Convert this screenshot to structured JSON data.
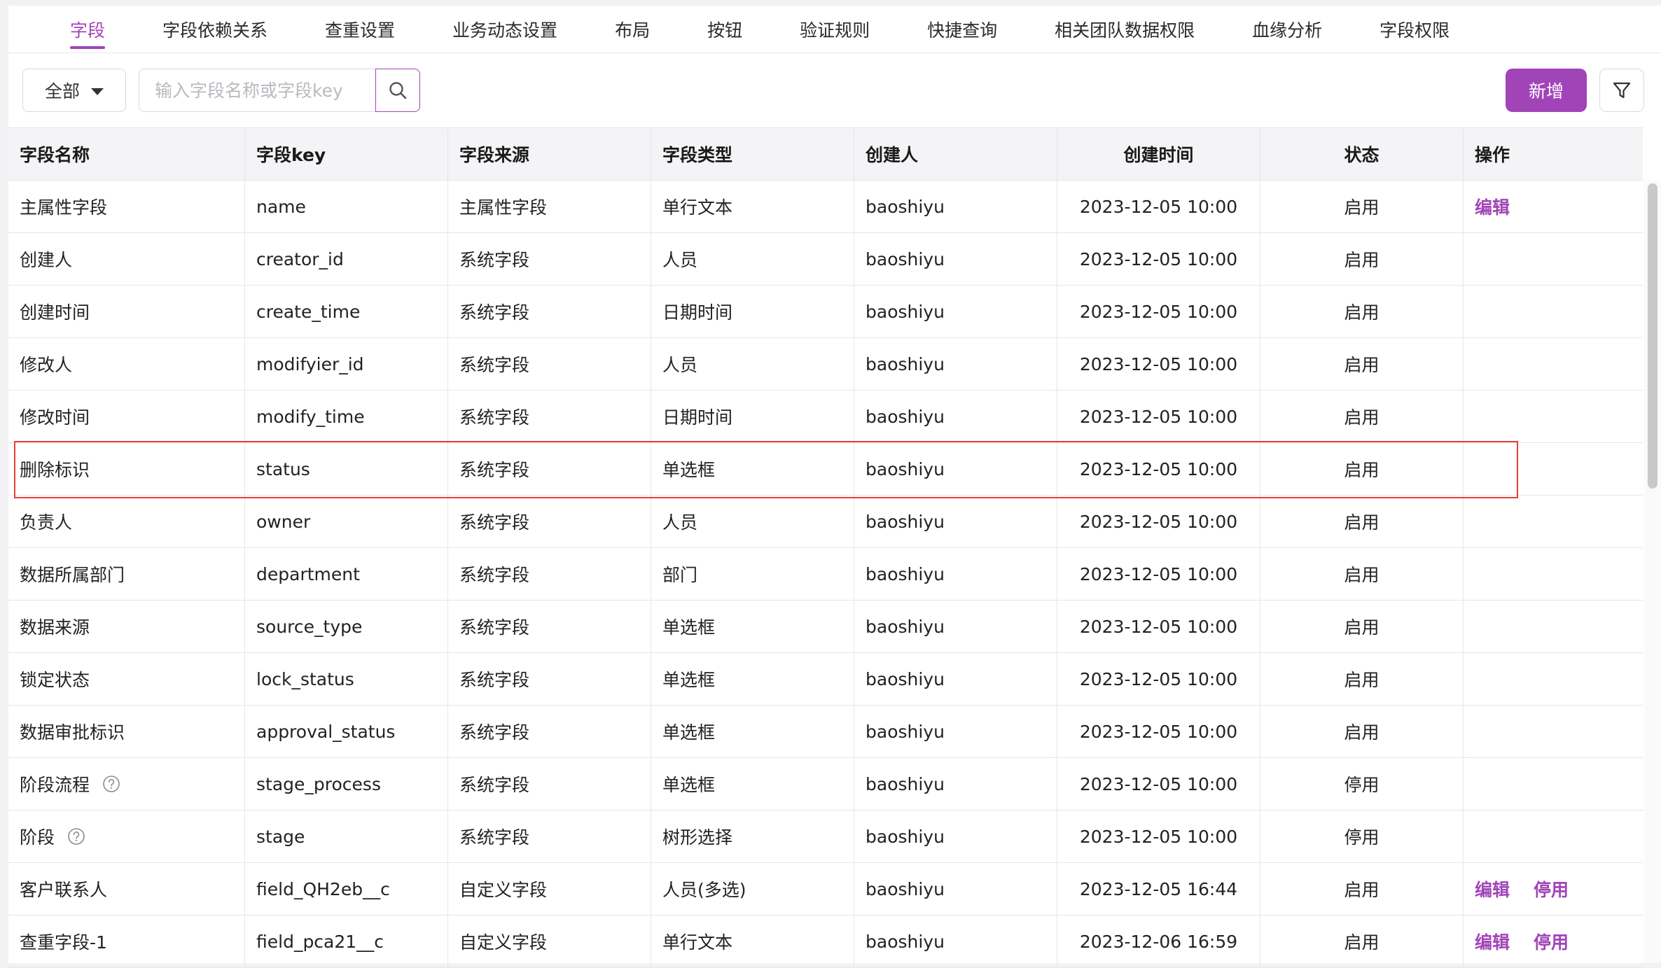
{
  "tabs": [
    {
      "label": "字段"
    },
    {
      "label": "字段依赖关系"
    },
    {
      "label": "查重设置"
    },
    {
      "label": "业务动态设置"
    },
    {
      "label": "布局"
    },
    {
      "label": "按钮"
    },
    {
      "label": "验证规则"
    },
    {
      "label": "快捷查询"
    },
    {
      "label": "相关团队数据权限"
    },
    {
      "label": "血缘分析"
    },
    {
      "label": "字段权限"
    }
  ],
  "active_tab": "字段",
  "toolbar": {
    "scope": "全部",
    "search_placeholder": "输入字段名称或字段key",
    "add_label": "新增"
  },
  "table": {
    "columns": [
      "字段名称",
      "字段key",
      "字段来源",
      "字段类型",
      "创建人",
      "创建时间",
      "状态",
      "操作"
    ],
    "rows": [
      {
        "name": "主属性字段",
        "key": "name",
        "source": "主属性字段",
        "type": "单行文本",
        "creator": "baoshiyu",
        "created": "2023-12-05 10:00",
        "status": "启用",
        "actions": [
          "编辑"
        ]
      },
      {
        "name": "创建人",
        "key": "creator_id",
        "source": "系统字段",
        "type": "人员",
        "creator": "baoshiyu",
        "created": "2023-12-05 10:00",
        "status": "启用",
        "actions": []
      },
      {
        "name": "创建时间",
        "key": "create_time",
        "source": "系统字段",
        "type": "日期时间",
        "creator": "baoshiyu",
        "created": "2023-12-05 10:00",
        "status": "启用",
        "actions": []
      },
      {
        "name": "修改人",
        "key": "modifyier_id",
        "source": "系统字段",
        "type": "人员",
        "creator": "baoshiyu",
        "created": "2023-12-05 10:00",
        "status": "启用",
        "actions": []
      },
      {
        "name": "修改时间",
        "key": "modify_time",
        "source": "系统字段",
        "type": "日期时间",
        "creator": "baoshiyu",
        "created": "2023-12-05 10:00",
        "status": "启用",
        "actions": []
      },
      {
        "name": "删除标识",
        "key": "status",
        "source": "系统字段",
        "type": "单选框",
        "creator": "baoshiyu",
        "created": "2023-12-05 10:00",
        "status": "启用",
        "actions": []
      },
      {
        "name": "负责人",
        "key": "owner",
        "source": "系统字段",
        "type": "人员",
        "creator": "baoshiyu",
        "created": "2023-12-05 10:00",
        "status": "启用",
        "actions": []
      },
      {
        "name": "数据所属部门",
        "key": "department",
        "source": "系统字段",
        "type": "部门",
        "creator": "baoshiyu",
        "created": "2023-12-05 10:00",
        "status": "启用",
        "actions": []
      },
      {
        "name": "数据来源",
        "key": "source_type",
        "source": "系统字段",
        "type": "单选框",
        "creator": "baoshiyu",
        "created": "2023-12-05 10:00",
        "status": "启用",
        "actions": []
      },
      {
        "name": "锁定状态",
        "key": "lock_status",
        "source": "系统字段",
        "type": "单选框",
        "creator": "baoshiyu",
        "created": "2023-12-05 10:00",
        "status": "启用",
        "actions": []
      },
      {
        "name": "数据审批标识",
        "key": "approval_status",
        "source": "系统字段",
        "type": "单选框",
        "creator": "baoshiyu",
        "created": "2023-12-05 10:00",
        "status": "启用",
        "actions": []
      },
      {
        "name": "阶段流程",
        "key": "stage_process",
        "source": "系统字段",
        "type": "单选框",
        "creator": "baoshiyu",
        "created": "2023-12-05 10:00",
        "status": "停用",
        "actions": [],
        "help": true
      },
      {
        "name": "阶段",
        "key": "stage",
        "source": "系统字段",
        "type": "树形选择",
        "creator": "baoshiyu",
        "created": "2023-12-05 10:00",
        "status": "停用",
        "actions": [],
        "help": true
      },
      {
        "name": "客户联系人",
        "key": "field_QH2eb__c",
        "source": "自定义字段",
        "type": "人员(多选)",
        "creator": "baoshiyu",
        "created": "2023-12-05 16:44",
        "status": "启用",
        "actions": [
          "编辑",
          "停用"
        ]
      },
      {
        "name": "查重字段-1",
        "key": "field_pca21__c",
        "source": "自定义字段",
        "type": "单行文本",
        "creator": "baoshiyu",
        "created": "2023-12-06 16:59",
        "status": "启用",
        "actions": [
          "编辑",
          "停用"
        ]
      }
    ]
  },
  "colors": {
    "accent": "#a144b8",
    "highlight_border": "#e4413a"
  },
  "icons": {
    "search": "search-icon",
    "filter": "filter-icon",
    "dropdown": "caret-down-icon",
    "help": "question-circle-icon"
  }
}
